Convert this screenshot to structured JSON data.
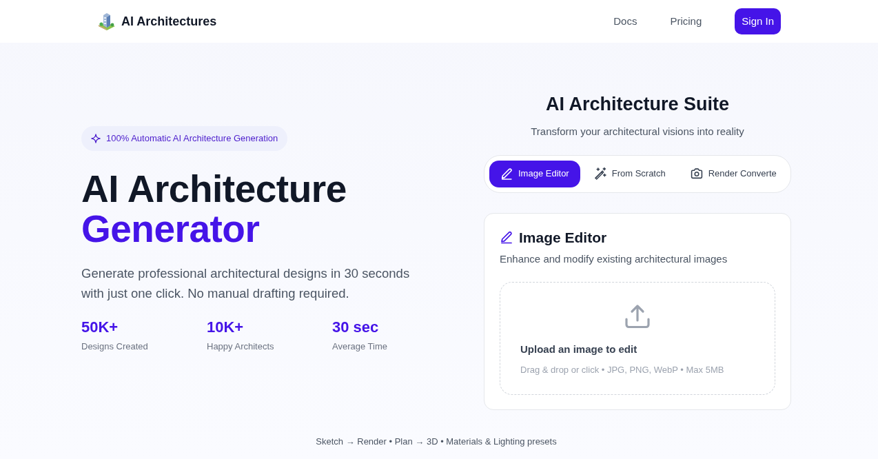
{
  "navbar": {
    "brand": "AI Architectures",
    "links": [
      {
        "label": "Docs"
      },
      {
        "label": "Pricing"
      }
    ],
    "button": "Sign In"
  },
  "hero": {
    "badge": "100% Automatic AI Architecture Generation",
    "title_line_1": "AI Architecture",
    "title_line_2": "Generator",
    "description": "Generate professional architectural designs in 30 seconds with just one click. No manual drafting required.",
    "stats": [
      {
        "value": "50K+",
        "label": "Designs Created"
      },
      {
        "value": "10K+",
        "label": "Happy Architects"
      },
      {
        "value": "30 sec",
        "label": "Average Time"
      }
    ]
  },
  "suite": {
    "title": "AI Architecture Suite",
    "subtitle": "Transform your architectural visions into reality",
    "tabs": [
      {
        "label": "Image Editor",
        "selected": true
      },
      {
        "label": "From Scratch",
        "selected": false
      },
      {
        "label": "Render Converte",
        "selected": false
      }
    ],
    "panel": {
      "title": "Image Editor",
      "subtitle": "Enhance and modify existing architectural images",
      "dropzone": {
        "title": "Upload an image to edit",
        "hint": "Drag & drop or click • JPG, PNG, WebP • Max 5MB"
      }
    }
  },
  "footer_note": "Sketch → Render • Plan → 3D • Materials & Lighting presets"
}
